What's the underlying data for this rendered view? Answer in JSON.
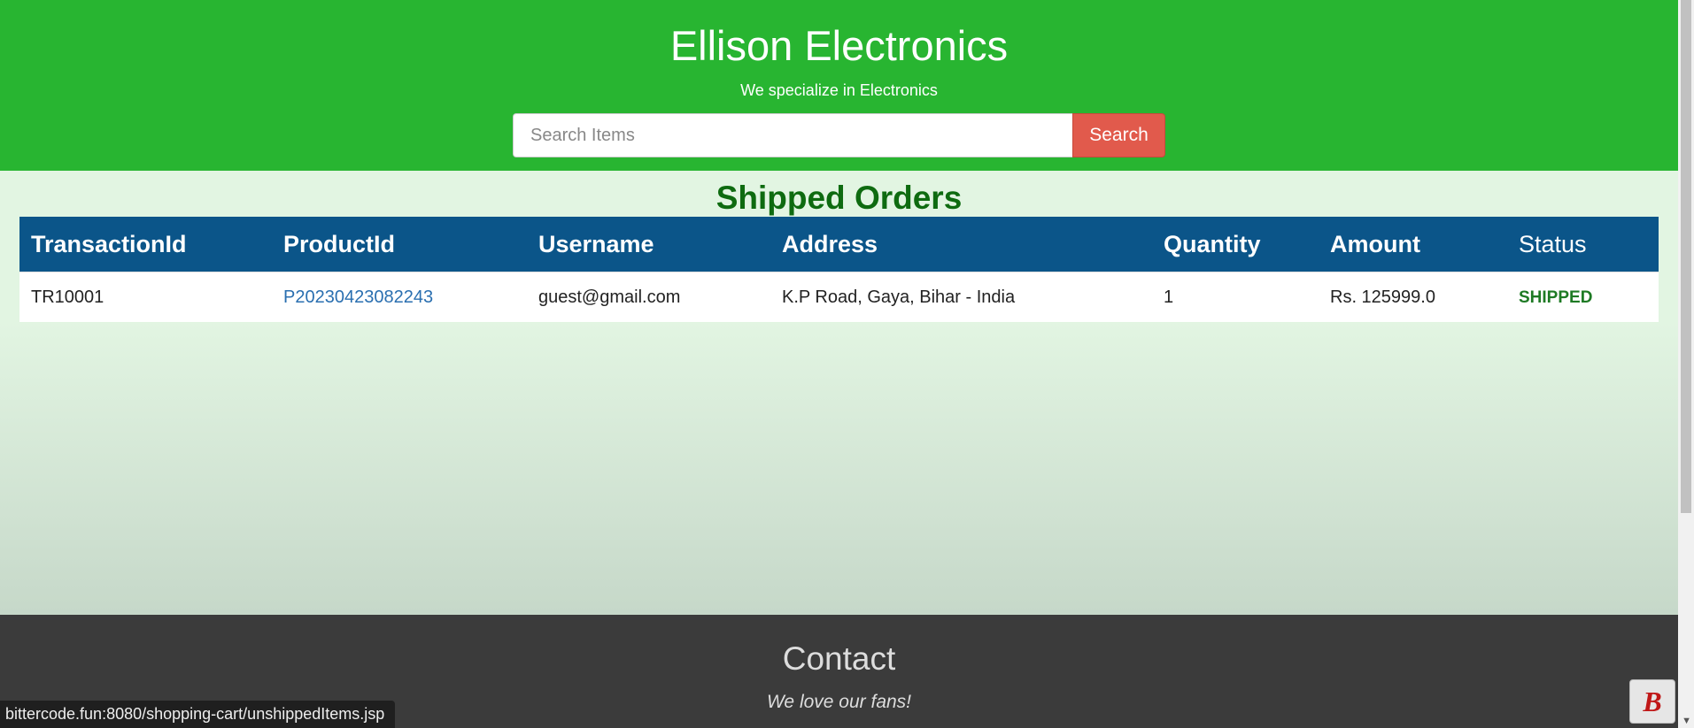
{
  "header": {
    "brand": "Ellison Electronics",
    "tagline": "We specialize in Electronics",
    "search_placeholder": "Search Items",
    "search_label": "Search"
  },
  "main": {
    "title": "Shipped Orders",
    "columns": [
      "TransactionId",
      "ProductId",
      "Username",
      "Address",
      "Quantity",
      "Amount",
      "Status"
    ],
    "rows": [
      {
        "transaction_id": "TR10001",
        "product_id": "P20230423082243",
        "username": "guest@gmail.com",
        "address": "K.P Road, Gaya, Bihar - India",
        "quantity": "1",
        "amount": "Rs. 125999.0",
        "status": "SHIPPED"
      }
    ]
  },
  "footer": {
    "title": "Contact",
    "subtitle": "We love our fans!"
  },
  "status_bar": {
    "url": "bittercode.fun:8080/shopping-cart/unshippedItems.jsp"
  },
  "colors": {
    "header_bg": "#28b531",
    "table_header_bg": "#0b5589",
    "search_button": "#e15a4c",
    "title_green": "#0e6b10",
    "footer_bg": "#3b3b3b"
  },
  "icons": {
    "corner_badge": "bittercode-logo-icon",
    "scroll_down": "chevron-down-icon"
  }
}
